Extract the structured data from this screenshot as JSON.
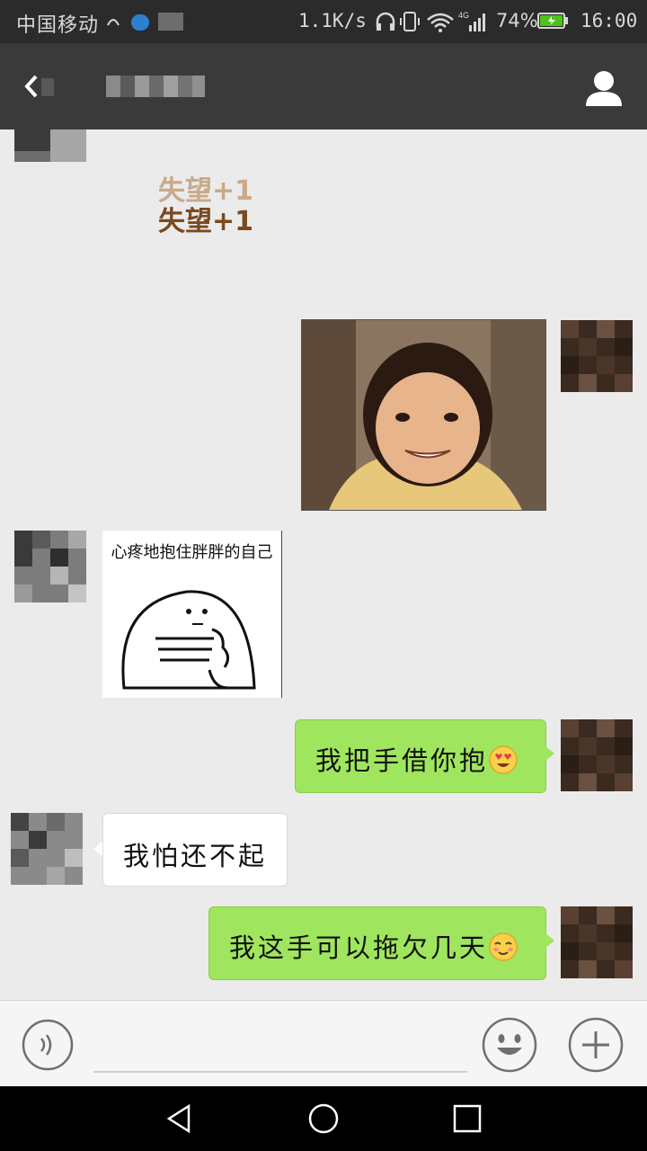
{
  "status_bar": {
    "carrier": "中国移动",
    "network_speed": "1.1K/s",
    "network_type": "4G",
    "battery_percent": "74%",
    "battery_level": 0.74,
    "time": "16:00",
    "icons": [
      "missed-call-icon",
      "app-notification-icon",
      "headphones-icon",
      "vibrate-icon",
      "wifi-icon",
      "signal-icon",
      "battery-charging-icon"
    ]
  },
  "title_bar": {
    "back_icon": "chevron-left-icon",
    "profile_icon": "user-icon",
    "title_obscured": true
  },
  "messages": [
    {
      "sender": "other",
      "type": "sticker",
      "sticker_text_1": "失望+1",
      "sticker_text_2": "失望+1"
    },
    {
      "sender": "me",
      "type": "image",
      "description_icon": "photo"
    },
    {
      "sender": "other",
      "type": "sticker",
      "caption": "心疼地抱住胖胖的自己"
    },
    {
      "sender": "me",
      "type": "text",
      "text": "我把手借你抱",
      "emoji": "heart-eyes-emoji"
    },
    {
      "sender": "other",
      "type": "text",
      "text": "我怕还不起"
    },
    {
      "sender": "me",
      "type": "text",
      "text": "我这手可以拖欠几天",
      "emoji": "relieved-emoji"
    }
  ],
  "input_bar": {
    "voice_icon": "voice-icon",
    "emoji_icon": "smiley-icon",
    "more_icon": "plus-icon"
  },
  "nav_bar": {
    "icons": [
      "nav-back-icon",
      "nav-home-icon",
      "nav-recent-icon"
    ]
  },
  "colors": {
    "title_bar_bg": "#3a3a3b",
    "chat_bg": "#ebebeb",
    "bubble_out": "#9fe65e",
    "bubble_in": "#ffffff",
    "sticker_text_light": "#c9a98a",
    "sticker_text_dark": "#7a4a1e"
  }
}
